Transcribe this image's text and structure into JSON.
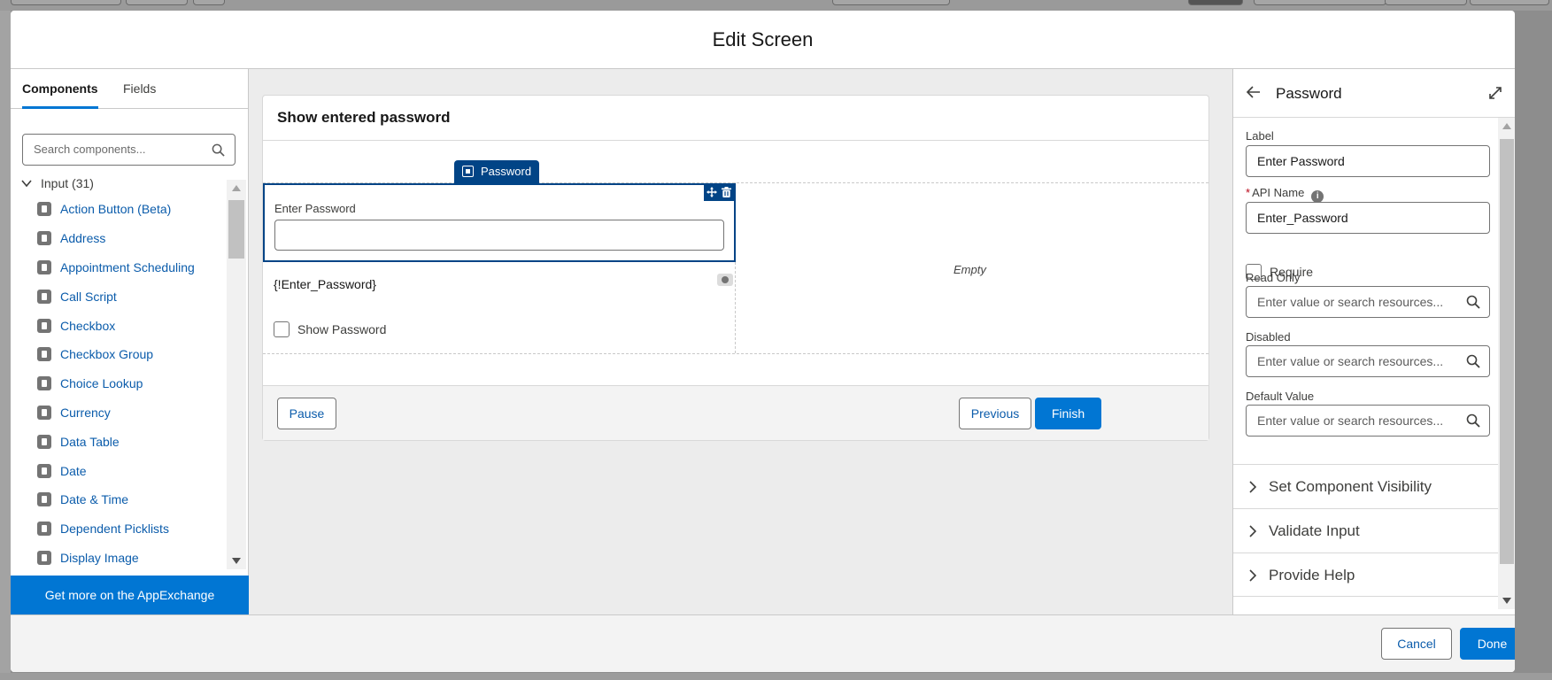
{
  "modal": {
    "title": "Edit Screen"
  },
  "palette": {
    "tabs": [
      {
        "label": "Components",
        "active": true
      },
      {
        "label": "Fields",
        "active": false
      }
    ],
    "search_placeholder": "Search components...",
    "group_label": "Input (31)",
    "items": [
      {
        "label": "Action Button (Beta)",
        "icon": "lightning-icon"
      },
      {
        "label": "Address",
        "icon": "location-icon"
      },
      {
        "label": "Appointment Scheduling",
        "icon": "lightning-icon"
      },
      {
        "label": "Call Script",
        "icon": "lightning-icon"
      },
      {
        "label": "Checkbox",
        "icon": "check-icon"
      },
      {
        "label": "Checkbox Group",
        "icon": "multi-check-icon"
      },
      {
        "label": "Choice Lookup",
        "icon": "lightning-icon"
      },
      {
        "label": "Currency",
        "icon": "currency-icon"
      },
      {
        "label": "Data Table",
        "icon": "lightning-icon"
      },
      {
        "label": "Date",
        "icon": "calendar-icon"
      },
      {
        "label": "Date & Time",
        "icon": "calendar-clock-icon"
      },
      {
        "label": "Dependent Picklists",
        "icon": "list-icon"
      },
      {
        "label": "Display Image",
        "icon": "image-icon"
      }
    ],
    "appexchange_label": "Get more on the AppExchange"
  },
  "canvas": {
    "screen_title": "Show entered password",
    "component_tag": "Password",
    "field_label": "Enter Password",
    "merge_field": "{!Enter_Password}",
    "checkbox_label": "Show Password",
    "empty_label": "Empty",
    "buttons": {
      "pause": "Pause",
      "previous": "Previous",
      "finish": "Finish"
    }
  },
  "properties": {
    "title": "Password",
    "label_label": "Label",
    "label_value": "Enter Password",
    "api_name_label": "API Name",
    "api_name_value": "Enter_Password",
    "require_label": "Require",
    "read_only_label": "Read Only",
    "disabled_label": "Disabled",
    "default_value_label": "Default Value",
    "resource_placeholder": "Enter value or search resources...",
    "sections": [
      "Set Component Visibility",
      "Validate Input",
      "Provide Help"
    ]
  },
  "footer": {
    "cancel": "Cancel",
    "done": "Done"
  },
  "colors": {
    "brand": "#0176d3",
    "selection": "#014486",
    "link": "#0b5cab"
  }
}
